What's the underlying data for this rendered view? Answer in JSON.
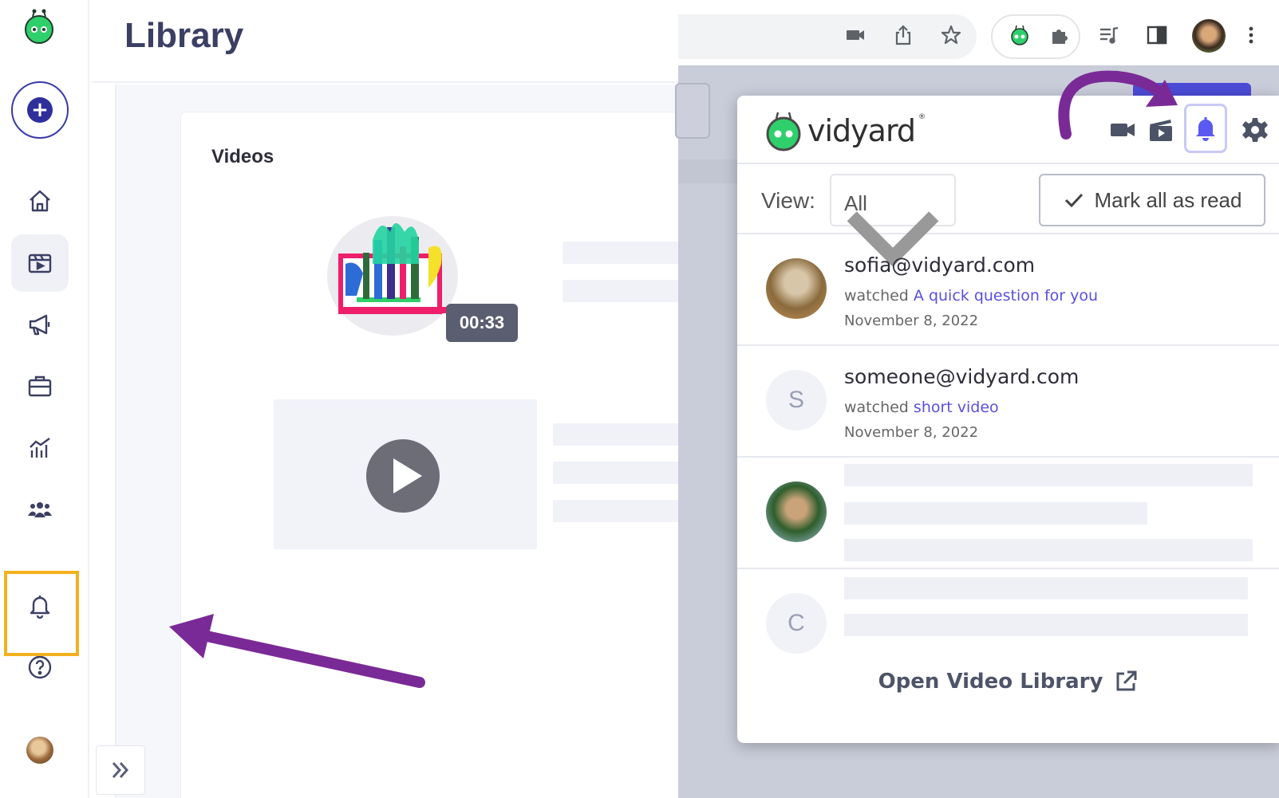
{
  "library": {
    "title": "Library",
    "videos_heading": "Videos",
    "video_duration": "00:33"
  },
  "sidebar": {
    "items": [
      {
        "name": "home"
      },
      {
        "name": "library"
      },
      {
        "name": "campaigns"
      },
      {
        "name": "hubs"
      },
      {
        "name": "analytics"
      },
      {
        "name": "team"
      },
      {
        "name": "notifications"
      },
      {
        "name": "help"
      }
    ]
  },
  "vidyard_popup": {
    "brand": "vidyard",
    "view_label": "View:",
    "view_selected": "All",
    "mark_all_label": "Mark all as read",
    "notifications": [
      {
        "email": "sofia@vidyard.com",
        "verb": "watched",
        "video": "A quick question for you",
        "date": "November 8, 2022",
        "avatar": "photo"
      },
      {
        "email": "someone@vidyard.com",
        "verb": "watched",
        "video": "short video",
        "date": "November 8, 2022",
        "avatar_letter": "S"
      },
      {
        "avatar": "photo",
        "loading": true
      },
      {
        "avatar_letter": "C",
        "loading": true
      }
    ],
    "open_library_label": "Open Video Library"
  },
  "colors": {
    "accent": "#5a4fe0",
    "annotation_arrow": "#7a2a96",
    "highlight_box": "#f2b01e",
    "bell_active": "#5a5af0"
  }
}
